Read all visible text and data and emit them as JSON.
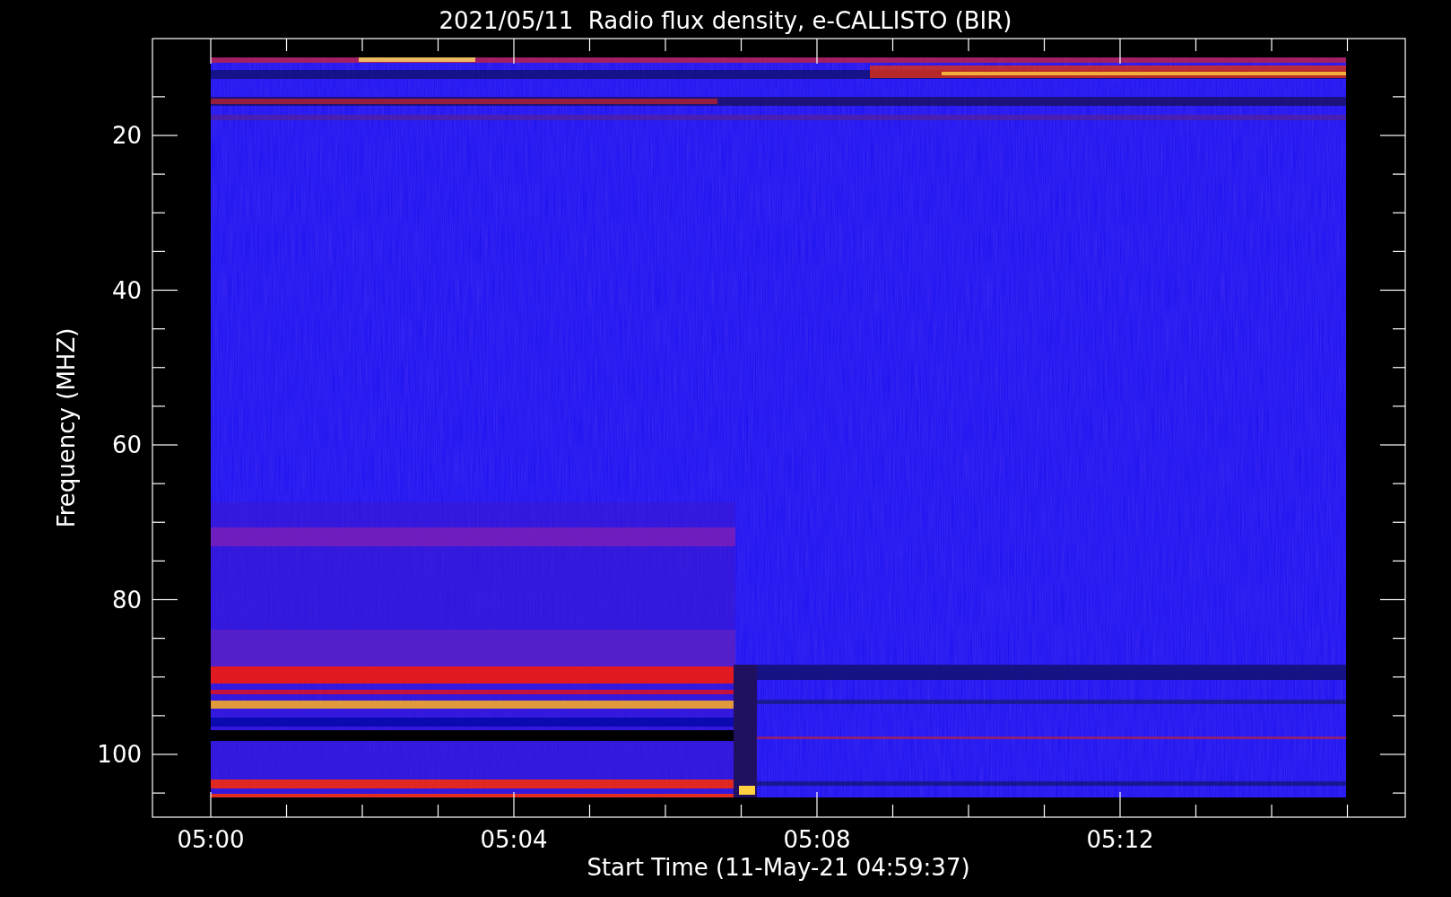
{
  "plot": {
    "title": "2021/05/11  Radio flux density, e-CALLISTO (BIR)",
    "xlabel": "Start Time (11-May-21 04:59:37)",
    "ylabel": "Frequency (MHZ)",
    "xtick_labels": [
      "05:00",
      "05:04",
      "05:08",
      "05:12"
    ],
    "ytick_labels": [
      "20",
      "40",
      "60",
      "80",
      "100"
    ]
  }
}
